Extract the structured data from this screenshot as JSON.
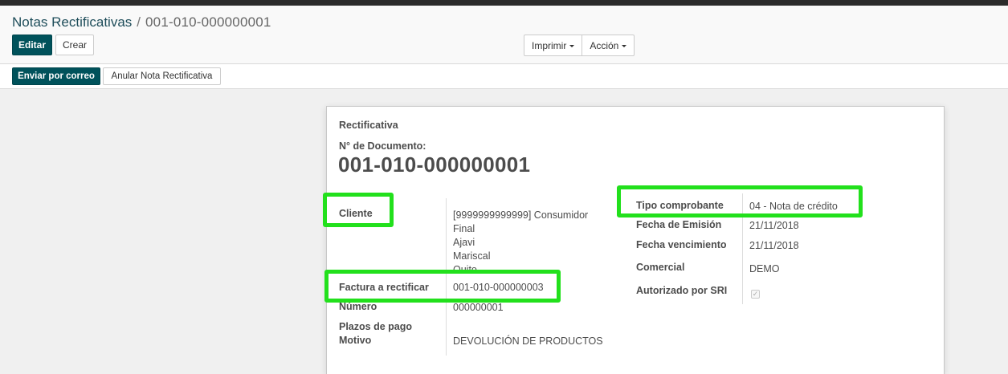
{
  "breadcrumb": {
    "parent": "Notas Rectificativas",
    "separator": "/",
    "current": "001-010-000000001"
  },
  "toolbar": {
    "edit_label": "Editar",
    "create_label": "Crear",
    "print_label": "Imprimir",
    "action_label": "Acción"
  },
  "statusbar": {
    "email_label": "Enviar por correo",
    "cancel_label": "Anular Nota Rectificativa"
  },
  "form": {
    "type_label": "Rectificativa",
    "doc_label": "N° de Documento:",
    "doc_number": "001-010-000000001",
    "left": {
      "cliente_label": "Cliente",
      "cliente_lines": [
        "[9999999999999] Consumidor",
        "Final",
        "Ajavi",
        "Mariscal",
        "Quito"
      ],
      "factura_label": "Factura a rectificar",
      "factura_value": "001-010-000000003",
      "numero_label": "Número",
      "numero_value": "000000001",
      "plazos_label": "Plazos de pago",
      "plazos_value": "",
      "motivo_label": "Motivo",
      "motivo_value": "DEVOLUCIÓN DE PRODUCTOS"
    },
    "right": {
      "tipo_label": "Tipo comprobante",
      "tipo_value": "04 - Nota de crédito",
      "emision_label": "Fecha de Emisión",
      "emision_value": "21/11/2018",
      "vencimiento_label": "Fecha vencimiento",
      "vencimiento_value": "21/11/2018",
      "comercial_label": "Comercial",
      "comercial_value": "DEMO",
      "autorizado_label": "Autorizado por SRI",
      "autorizado_checked": true
    }
  },
  "colors": {
    "primary": "#00525b",
    "highlight": "#22e01c",
    "breadcrumb_link": "#1e4d5a"
  }
}
